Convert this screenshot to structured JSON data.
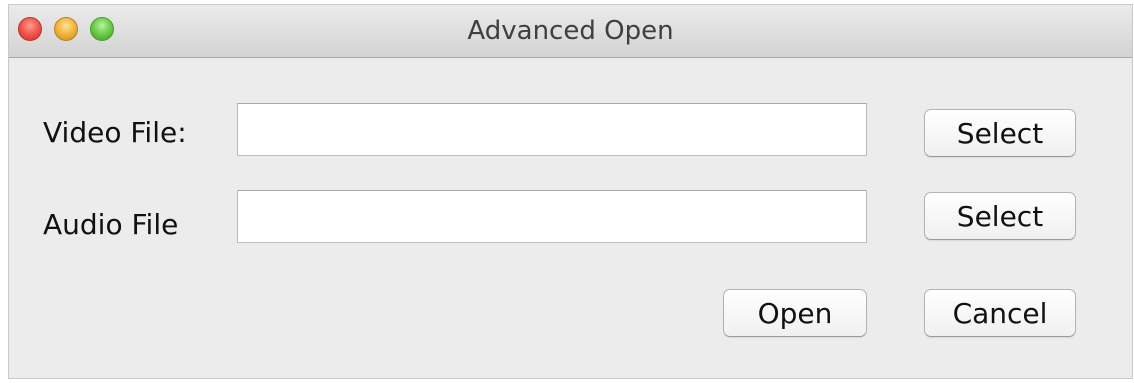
{
  "window": {
    "title": "Advanced Open"
  },
  "traffic_lights": {
    "close": "close-button",
    "minimize": "minimize-button",
    "zoom": "zoom-button"
  },
  "form": {
    "video_label": "Video File:",
    "video_value": "",
    "audio_label": "Audio File",
    "audio_value": ""
  },
  "buttons": {
    "select_video": "Select",
    "select_audio": "Select",
    "open": "Open",
    "cancel": "Cancel"
  }
}
